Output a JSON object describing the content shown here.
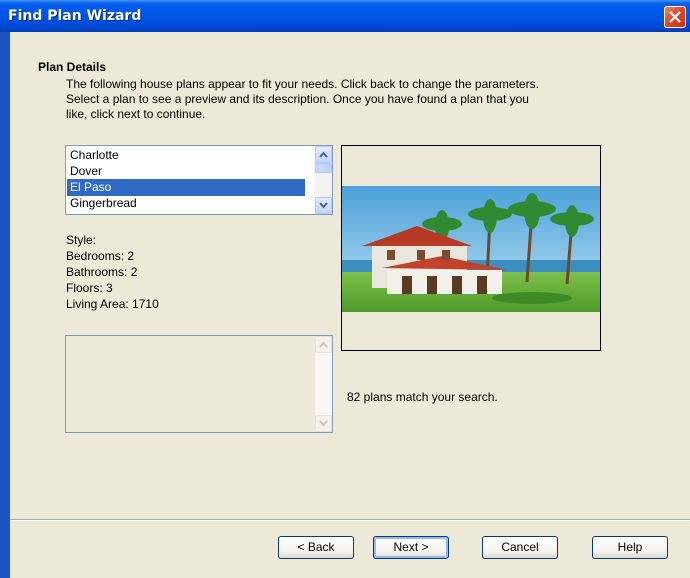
{
  "window": {
    "title": "Find Plan Wizard"
  },
  "section": {
    "heading": "Plan Details",
    "lines": [
      "The following house plans appear to fit your needs. Click back to change the parameters.",
      "Select a plan to see a preview and its description. Once you have found a plan that you",
      "like, click next to continue."
    ]
  },
  "plans": {
    "items": [
      "Charlotte",
      "Dover",
      "El Paso",
      "Gingerbread"
    ],
    "selected": "El Paso"
  },
  "details": {
    "style": "Style:",
    "bedrooms": "Bedrooms: 2",
    "bathrooms": "Bathrooms: 2",
    "floors": "Floors: 3",
    "living_area": "Living Area: 1710"
  },
  "preview": {
    "match_text": "82 plans match your search."
  },
  "buttons": {
    "back": "< Back",
    "next": "Next >",
    "cancel": "Cancel",
    "help": "Help"
  },
  "icons": {
    "close": "close-icon",
    "scroll_up": "arrow-up-icon",
    "scroll_down": "arrow-down-icon"
  },
  "colors": {
    "titlebar": "#0054e3",
    "client_bg": "#ece9d8",
    "selection": "#316ac5",
    "close": "#d9441c"
  }
}
